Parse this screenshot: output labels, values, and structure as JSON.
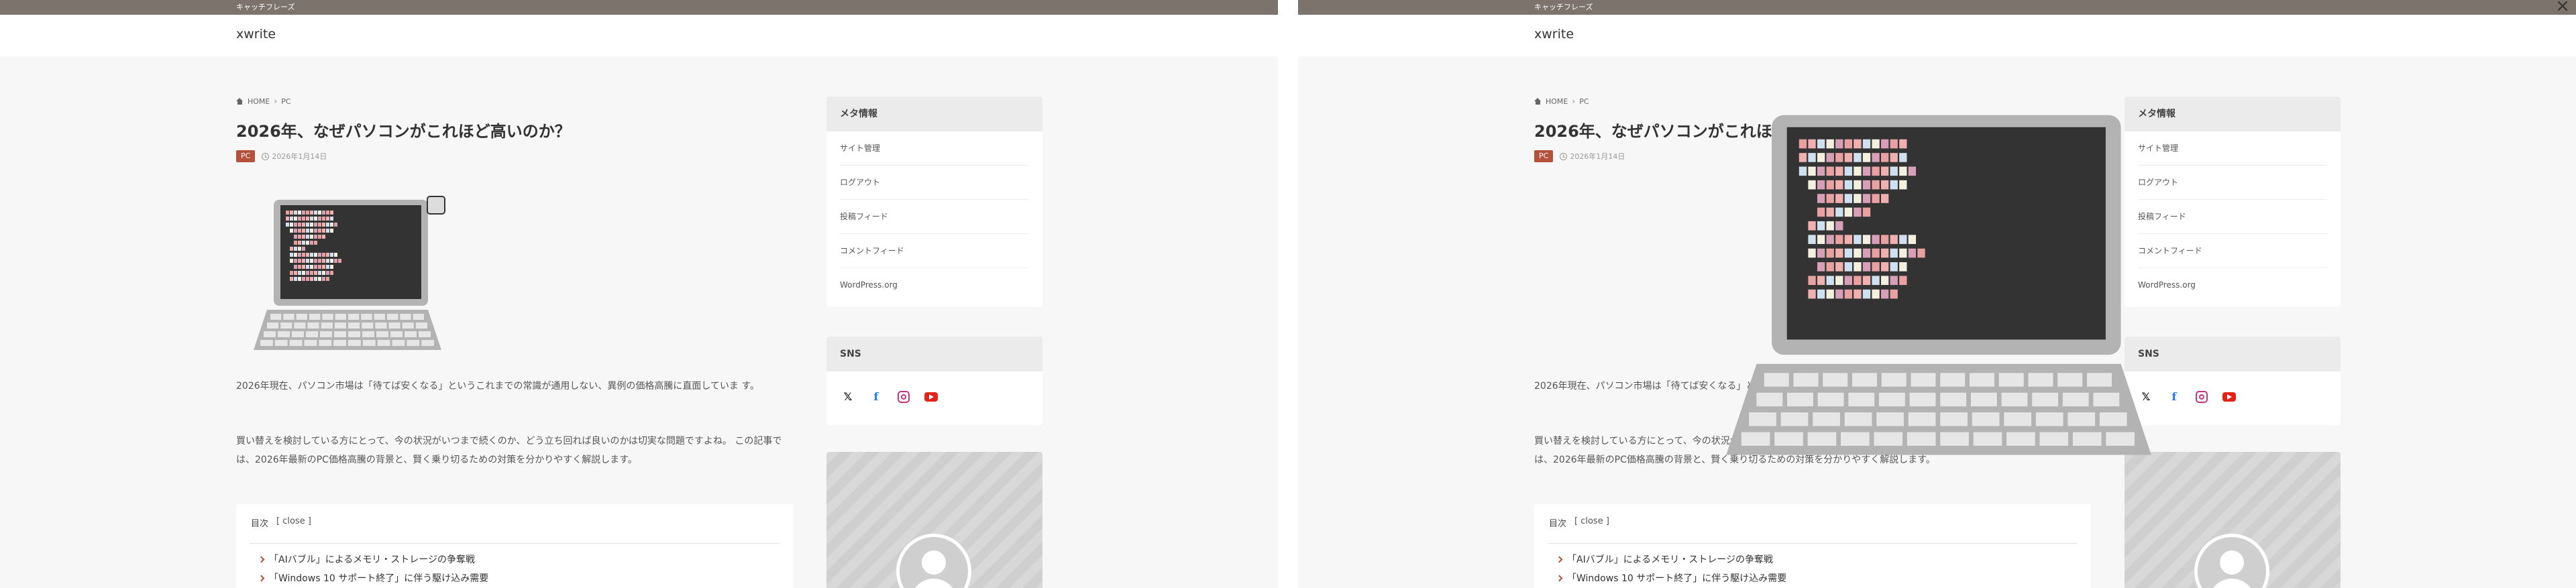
{
  "left_pane": {
    "catchphrase": "キャッチフレーズ",
    "site_name": "xwrite",
    "breadcrumb": {
      "home": "HOME",
      "category": "PC"
    },
    "post": {
      "title": "2026年、なぜパソコンがこれほど高いのか？",
      "category": "PC",
      "date": "2026年1月14日",
      "paragraph_1": "2026年現在、パソコン市場は「待てば安くなる」というこれまでの常識が通用しない、異例の価格高騰に直面していま す。",
      "paragraph_2": "買い替えを検討している方にとって、今の状況がいつまで続くのか、どう立ち回れば良いのかは切実な問題ですよね。 この記事では、2026年最新のPC価格高騰の背景と、賢く乗り切るための対策を分かりやすく解説します。"
    },
    "toc": {
      "title": "目次",
      "close_label": "[ close ]",
      "items": [
        "「AIバブル」によるメモリ・ストレージの争奪戦",
        "「Windows 10 サポート終了」に伴う駆け込み需要"
      ]
    },
    "sidebar": {
      "meta_title": "メタ情報",
      "meta_items": [
        "サイト管理",
        "ログアウト",
        "投稿フィード",
        "コメントフィード",
        "WordPress.org"
      ],
      "sns_title": "SNS",
      "sns_icons": [
        "x-icon",
        "facebook-icon",
        "instagram-icon",
        "youtube-icon"
      ]
    }
  },
  "right_pane": {
    "catchphrase": "キャッチフレーズ",
    "site_name": "xwrite",
    "breadcrumb": {
      "home": "HOME",
      "category": "PC"
    },
    "post": {
      "title": "2026年、なぜパソコンがこれほ",
      "category": "PC",
      "date": "2026年1月14日",
      "paragraph_1": "2026年現在、パソコン市場は「待てば安くなる」というこれまでの常識が通用しない、異例の価格高騰に直面していま す。",
      "paragraph_2": "買い替えを検討している方にとって、今の状況がいつまで続くのか、どう立ち回れば良いのかは切実な問題ですよね。 この記事では、2026年最新のPC価格高騰の背景と、賢く乗り切るための対策を分かりやすく解説します。"
    },
    "toc": {
      "title": "目次",
      "close_label": "[ close ]",
      "items": [
        "「AIバブル」によるメモリ・ストレージの争奪戦",
        "「Windows 10 サポート終了」に伴う駆け込み需要"
      ]
    },
    "sidebar": {
      "meta_title": "メタ情報",
      "meta_items": [
        "サイト管理",
        "ログアウト",
        "投稿フィード",
        "コメントフィード",
        "WordPress.org"
      ],
      "sns_title": "SNS"
    },
    "close_glyph": "×"
  },
  "colors": {
    "topbar": "#7b736c",
    "accent": "#b5503a",
    "background": "#f7f7f7",
    "laptop_body": "#b3b3b3",
    "screen": "#333333"
  }
}
